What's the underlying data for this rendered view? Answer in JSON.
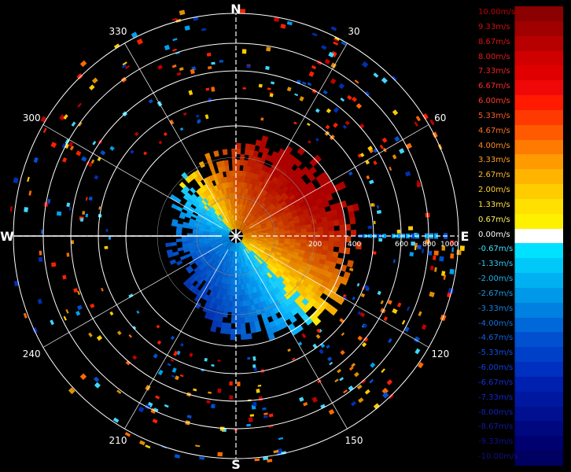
{
  "radar": {
    "cardinals": {
      "north": "N",
      "south": "S",
      "east": "E",
      "west": "W"
    },
    "azimuth_labels": [
      {
        "deg": 30,
        "label": "30"
      },
      {
        "deg": 60,
        "label": "60"
      },
      {
        "deg": 120,
        "label": "120"
      },
      {
        "deg": 150,
        "label": "150"
      },
      {
        "deg": 210,
        "label": "210"
      },
      {
        "deg": 240,
        "label": "240"
      },
      {
        "deg": 300,
        "label": "300"
      },
      {
        "deg": 330,
        "label": "330"
      }
    ],
    "range_labels": [
      "200",
      "400",
      "600",
      "800",
      "1000"
    ],
    "colors": {
      "background": "#000000",
      "grid": "#ffffff"
    }
  },
  "colorbar": {
    "entries": [
      {
        "label": "10.00m/s",
        "color": "#8b0000",
        "text_color": "#c00000"
      },
      {
        "label": "9.33m/s",
        "color": "#a00000",
        "text_color": "#d01010"
      },
      {
        "label": "8.67m/s",
        "color": "#b80000",
        "text_color": "#e01010"
      },
      {
        "label": "8.00m/s",
        "color": "#d00000",
        "text_color": "#e81818"
      },
      {
        "label": "7.33m/s",
        "color": "#e00000",
        "text_color": "#f02020"
      },
      {
        "label": "6.67m/s",
        "color": "#f00808",
        "text_color": "#ff2a2a"
      },
      {
        "label": "6.00m/s",
        "color": "#ff1a00",
        "text_color": "#ff3a20"
      },
      {
        "label": "5.33m/s",
        "color": "#ff3a00",
        "text_color": "#ff5a20"
      },
      {
        "label": "4.67m/s",
        "color": "#ff5a00",
        "text_color": "#ff7020"
      },
      {
        "label": "4.00m/s",
        "color": "#ff7a00",
        "text_color": "#ff8a20"
      },
      {
        "label": "3.33m/s",
        "color": "#ff9a00",
        "text_color": "#ffa020"
      },
      {
        "label": "2.67m/s",
        "color": "#ffb400",
        "text_color": "#ffb830"
      },
      {
        "label": "2.00m/s",
        "color": "#ffcc00",
        "text_color": "#ffd030"
      },
      {
        "label": "1.33m/s",
        "color": "#ffe000",
        "text_color": "#ffe040"
      },
      {
        "label": "0.67m/s",
        "color": "#fff000",
        "text_color": "#fff060"
      },
      {
        "label": "0.00m/s",
        "color": "#ffffff",
        "text_color": "#ffffff"
      },
      {
        "label": "-0.67m/s",
        "color": "#00e0ff",
        "text_color": "#40e0ff"
      },
      {
        "label": "-1.33m/s",
        "color": "#00c8f8",
        "text_color": "#30c8f8"
      },
      {
        "label": "-2.00m/s",
        "color": "#00b0f0",
        "text_color": "#20b0f0"
      },
      {
        "label": "-2.67m/s",
        "color": "#0098e8",
        "text_color": "#1898e8"
      },
      {
        "label": "-3.33m/s",
        "color": "#0080e0",
        "text_color": "#1080e0"
      },
      {
        "label": "-4.00m/s",
        "color": "#0068d8",
        "text_color": "#1070e0"
      },
      {
        "label": "-4.67m/s",
        "color": "#0050d0",
        "text_color": "#1060e0"
      },
      {
        "label": "-5.33m/s",
        "color": "#0040c8",
        "text_color": "#1050e0"
      },
      {
        "label": "-6.00m/s",
        "color": "#0030c0",
        "text_color": "#1040e0"
      },
      {
        "label": "-6.67m/s",
        "color": "#0020b0",
        "text_color": "#1030d8"
      },
      {
        "label": "-7.33m/s",
        "color": "#0018a0",
        "text_color": "#1028c8"
      },
      {
        "label": "-8.00m/s",
        "color": "#001090",
        "text_color": "#1020b8"
      },
      {
        "label": "-8.67m/s",
        "color": "#000880",
        "text_color": "#1018a8"
      },
      {
        "label": "-9.33m/s",
        "color": "#000070",
        "text_color": "#101098"
      },
      {
        "label": "-10.00m/s",
        "color": "#000060",
        "text_color": "#101088"
      }
    ]
  }
}
